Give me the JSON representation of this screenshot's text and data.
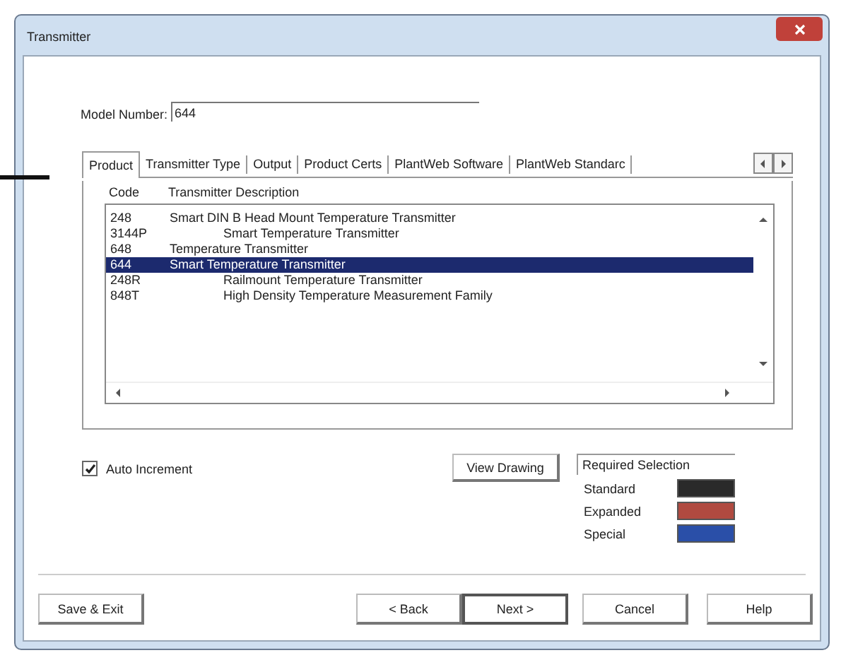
{
  "window": {
    "title": "Transmitter"
  },
  "model_number": {
    "label": "Model Number:",
    "value": "644"
  },
  "tabs": [
    {
      "label": "Product",
      "selected": true
    },
    {
      "label": "Transmitter Type",
      "selected": false
    },
    {
      "label": "Output",
      "selected": false
    },
    {
      "label": "Product Certs",
      "selected": false
    },
    {
      "label": "PlantWeb Software",
      "selected": false
    },
    {
      "label": "PlantWeb Standarc",
      "selected": false
    }
  ],
  "table": {
    "columns": [
      "Code",
      "Transmitter Description"
    ],
    "rows": [
      {
        "code": "248",
        "description": "Smart DIN B Head Mount Temperature Transmitter",
        "indented": false,
        "selected": false
      },
      {
        "code": "3144P",
        "description": "Smart Temperature Transmitter",
        "indented": true,
        "selected": false
      },
      {
        "code": "648",
        "description": "Temperature Transmitter",
        "indented": false,
        "selected": false
      },
      {
        "code": "644",
        "description": "Smart Temperature Transmitter",
        "indented": false,
        "selected": true
      },
      {
        "code": "248R",
        "description": "Railmount Temperature Transmitter",
        "indented": true,
        "selected": false
      },
      {
        "code": "848T",
        "description": "High Density Temperature Measurement Family",
        "indented": true,
        "selected": false
      }
    ]
  },
  "auto_increment": {
    "label": "Auto Increment",
    "checked": true
  },
  "view_drawing": "View Drawing",
  "required_selection": {
    "title": "Required Selection",
    "items": [
      {
        "label": "Standard",
        "color": "#2a2a2a"
      },
      {
        "label": "Expanded",
        "color": "#b04a40"
      },
      {
        "label": "Special",
        "color": "#2a4fa8"
      }
    ]
  },
  "buttons": {
    "left": [
      "Save & Exit"
    ],
    "right": [
      {
        "label": "< Back",
        "default": false
      },
      {
        "label": "Next >",
        "default": true
      },
      {
        "label": "Cancel",
        "default": false
      },
      {
        "label": "Help",
        "default": false
      }
    ]
  }
}
